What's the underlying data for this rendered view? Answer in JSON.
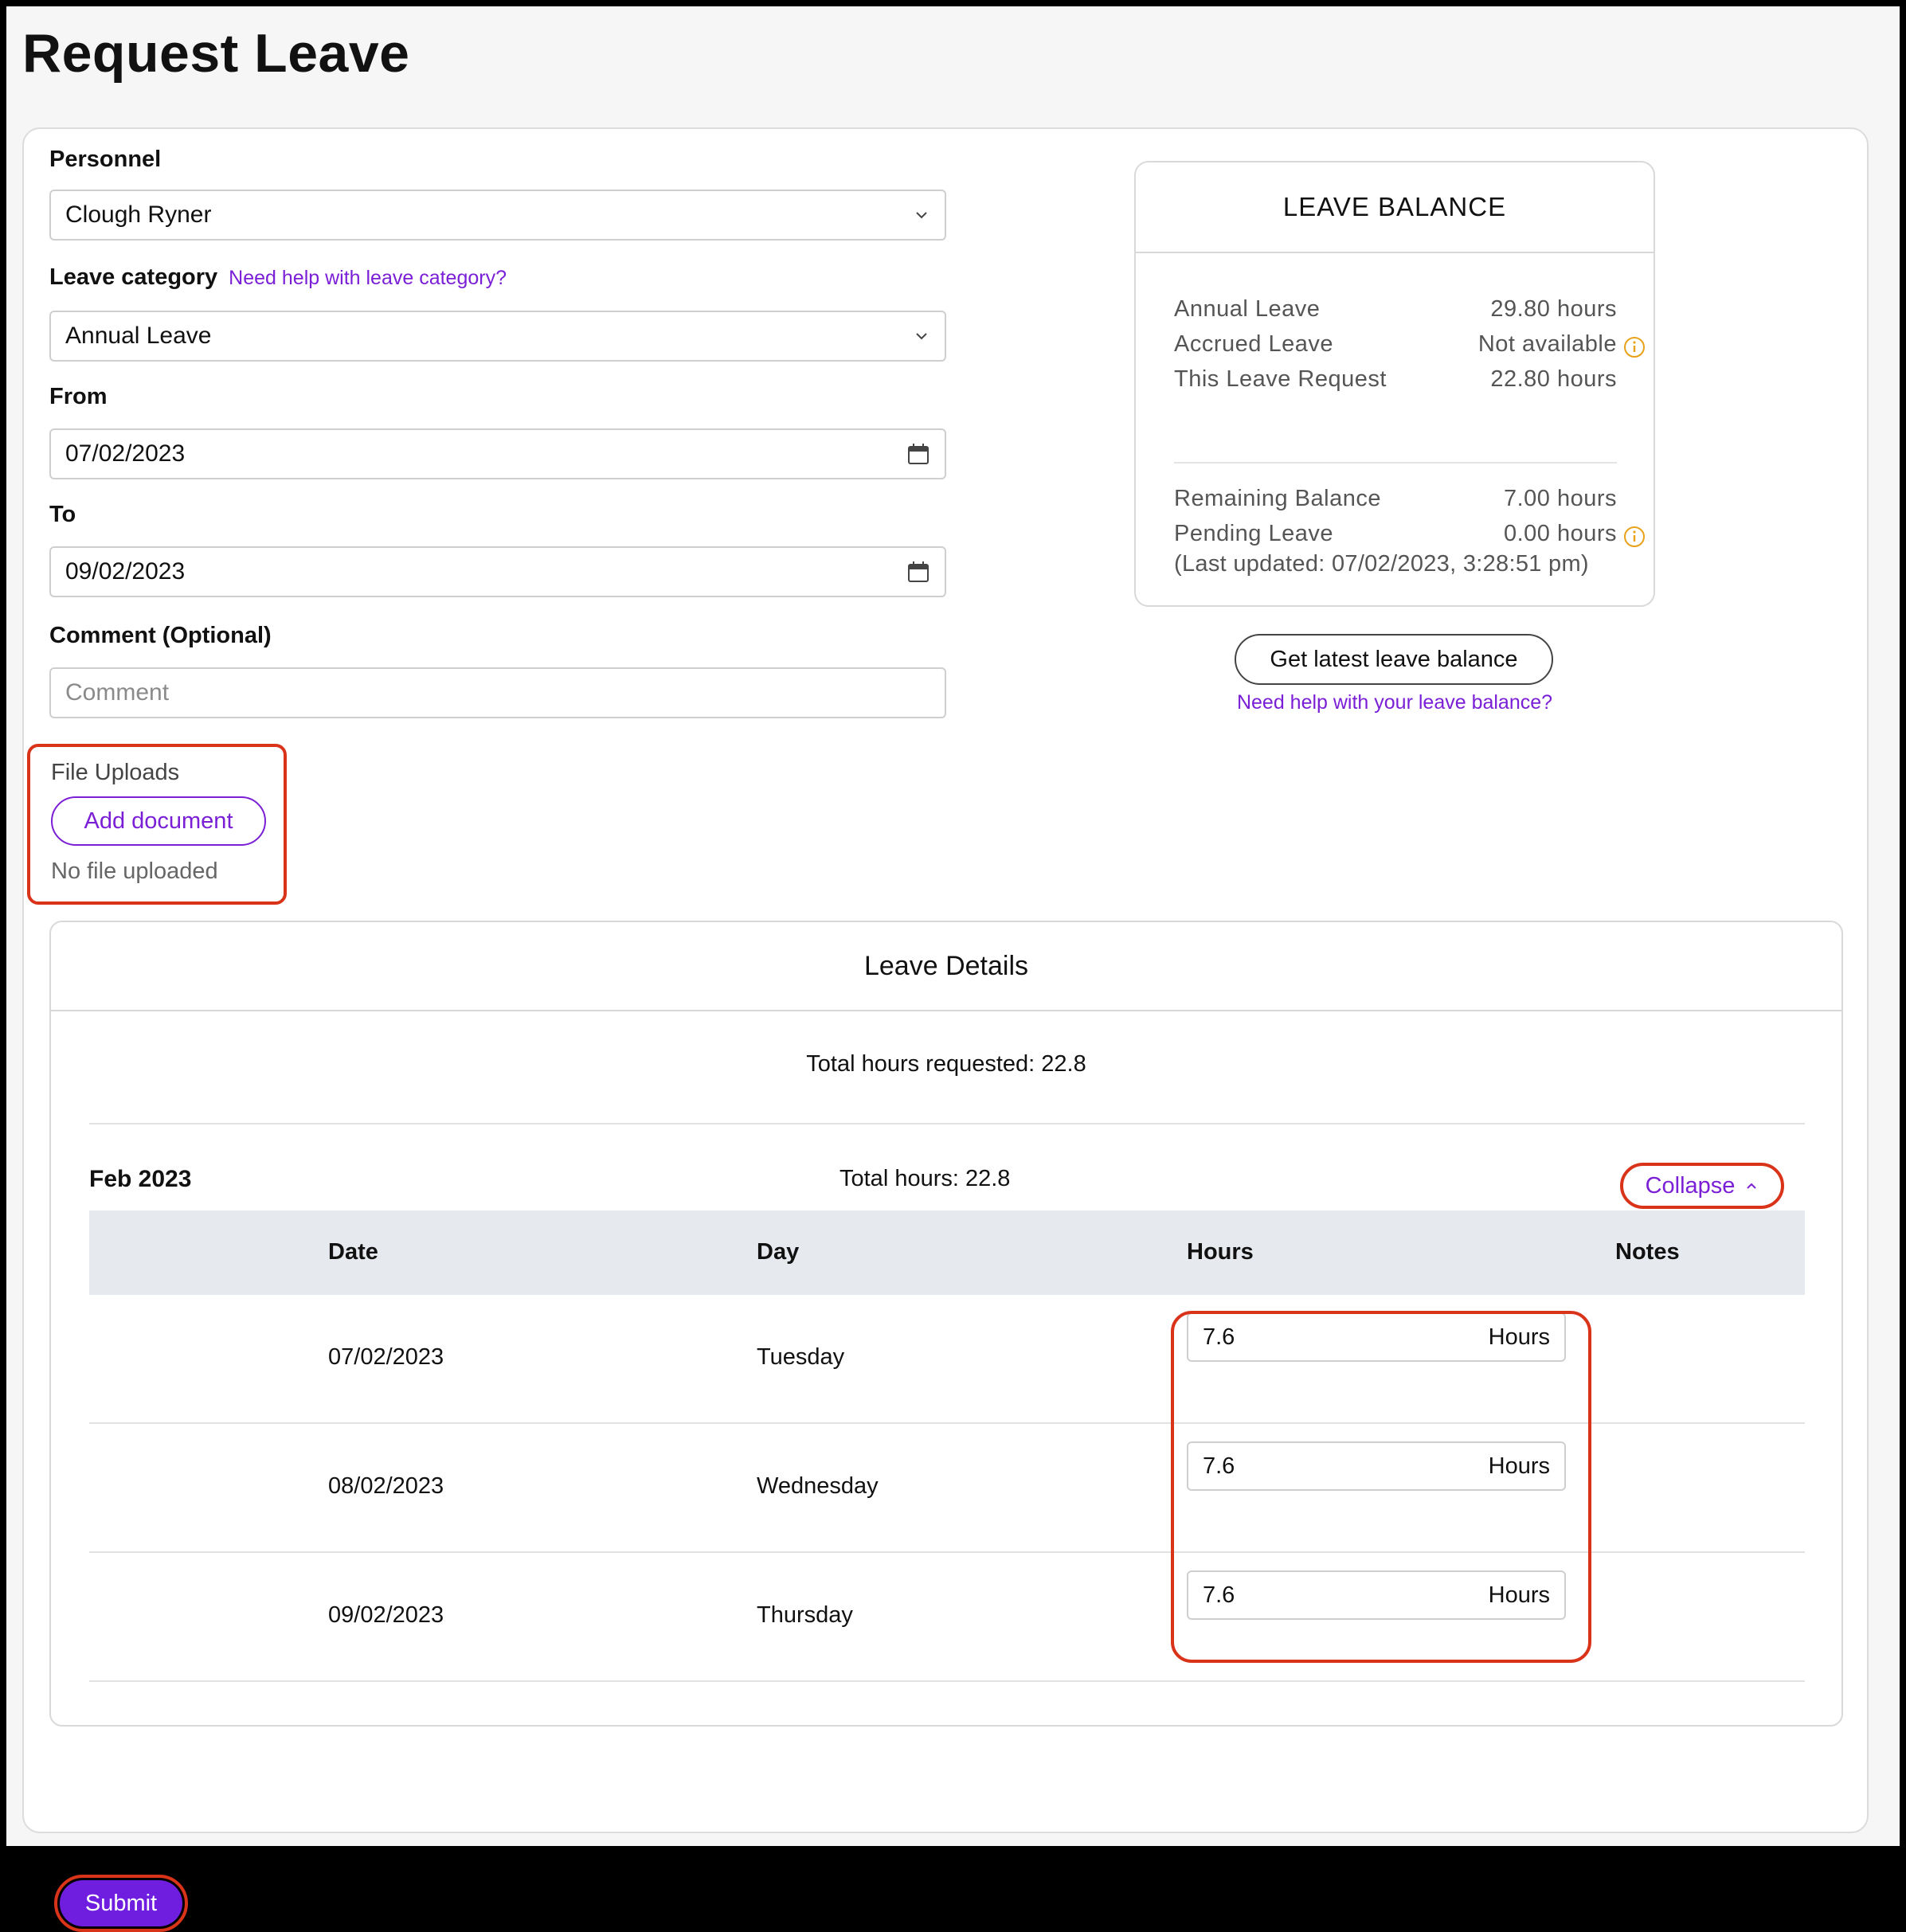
{
  "page": {
    "title": "Request Leave"
  },
  "form": {
    "personnel": {
      "label": "Personnel",
      "value": "Clough Ryner"
    },
    "leave_category": {
      "label": "Leave category",
      "help": "Need help with leave category?",
      "value": "Annual Leave"
    },
    "from": {
      "label": "From",
      "value": "07/02/2023"
    },
    "to": {
      "label": "To",
      "value": "09/02/2023"
    },
    "comment": {
      "label": "Comment (Optional)",
      "placeholder": "Comment"
    },
    "uploads": {
      "label": "File Uploads",
      "button": "Add document",
      "status": "No file uploaded"
    }
  },
  "balance": {
    "title": "LEAVE BALANCE",
    "rows": [
      {
        "label": "Annual Leave",
        "value": "29.80 hours"
      },
      {
        "label": "Accrued Leave",
        "value": "Not available"
      },
      {
        "label": "This Leave Request",
        "value": "22.80 hours"
      },
      {
        "label": "Remaining Balance",
        "value": "7.00 hours"
      },
      {
        "label": "Pending Leave",
        "value": "0.00 hours"
      }
    ],
    "updated": "(Last updated: 07/02/2023, 3:28:51 pm)",
    "refresh_button": "Get latest leave balance",
    "help": "Need help with your leave balance?"
  },
  "details": {
    "title": "Leave Details",
    "total_requested": "Total hours requested: 22.8",
    "month": "Feb 2023",
    "month_total": "Total hours: 22.8",
    "collapse": "Collapse",
    "columns": [
      "Date",
      "Day",
      "Hours",
      "Notes"
    ],
    "rows": [
      {
        "date": "07/02/2023",
        "day": "Tuesday",
        "hours": "7.6",
        "unit": "Hours"
      },
      {
        "date": "08/02/2023",
        "day": "Wednesday",
        "hours": "7.6",
        "unit": "Hours"
      },
      {
        "date": "09/02/2023",
        "day": "Thursday",
        "hours": "7.6",
        "unit": "Hours"
      }
    ]
  },
  "actions": {
    "submit": "Submit"
  },
  "colors": {
    "accent": "#6f1ee0",
    "link": "#7a1fd6",
    "highlight": "#d9331a",
    "info": "#e8a21a"
  }
}
